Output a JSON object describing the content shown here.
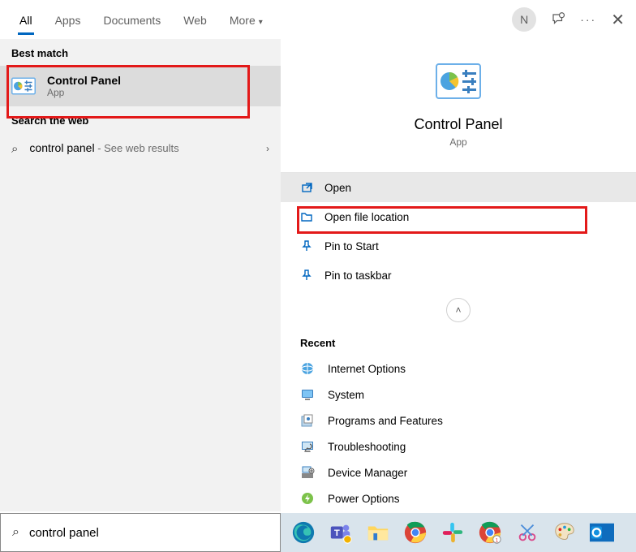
{
  "tabs": {
    "all": "All",
    "apps": "Apps",
    "documents": "Documents",
    "web": "Web",
    "more": "More"
  },
  "avatar_initial": "N",
  "left": {
    "best_match": "Best match",
    "result_title": "Control Panel",
    "result_sub": "App",
    "search_web_label": "Search the web",
    "web_query": "control panel",
    "web_hint": " - See web results"
  },
  "preview": {
    "title": "Control Panel",
    "sub": "App"
  },
  "actions": {
    "open": "Open",
    "open_file_location": "Open file location",
    "pin_start": "Pin to Start",
    "pin_taskbar": "Pin to taskbar"
  },
  "recent": {
    "label": "Recent",
    "items": [
      "Internet Options",
      "System",
      "Programs and Features",
      "Troubleshooting",
      "Device Manager",
      "Power Options"
    ]
  },
  "search_value": "control panel"
}
